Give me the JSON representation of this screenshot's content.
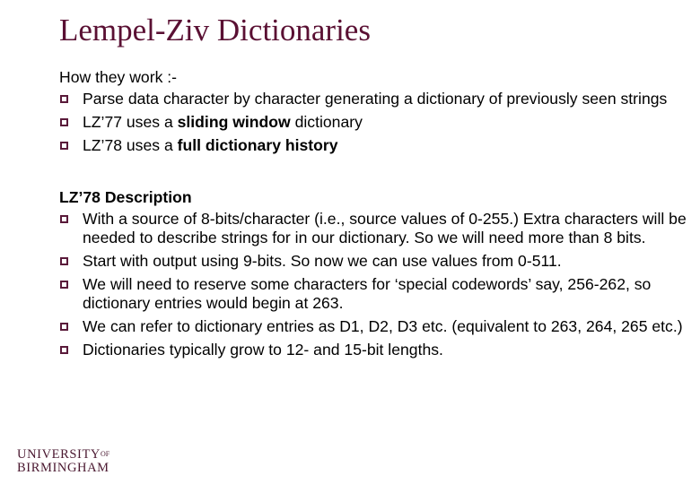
{
  "title": "Lempel-Ziv Dictionaries",
  "section1": {
    "heading": "How they work :-",
    "items": [
      {
        "parts": [
          {
            "text": "Parse data character by character generating a dictionary of previously seen strings",
            "bold": false
          }
        ]
      },
      {
        "parts": [
          {
            "text": "LZ’77 uses a ",
            "bold": false
          },
          {
            "text": "sliding window",
            "bold": true
          },
          {
            "text": " dictionary",
            "bold": false
          }
        ]
      },
      {
        "parts": [
          {
            "text": "LZ’78 uses a ",
            "bold": false
          },
          {
            "text": "full dictionary history",
            "bold": true
          }
        ]
      }
    ]
  },
  "section2": {
    "heading": "LZ’78 Description",
    "items": [
      {
        "parts": [
          {
            "text": "With a source of 8-bits/character (i.e., source values of 0-255.)  Extra characters will be needed to describe strings for in our dictionary. So we will need more than 8 bits.",
            "bold": false
          }
        ]
      },
      {
        "parts": [
          {
            "text": "Start with output using 9-bits.  So now we can use values from 0-511.",
            "bold": false
          }
        ]
      },
      {
        "parts": [
          {
            "text": "We will need to reserve some characters for ‘special codewords’ say, 256-262, so dictionary entries would begin at 263.",
            "bold": false
          }
        ]
      },
      {
        "parts": [
          {
            "text": "We can refer to dictionary entries as D1, D2, D3 etc. (equivalent to 263, 264, 265 etc.)",
            "bold": false
          }
        ]
      },
      {
        "parts": [
          {
            "text": "Dictionaries typically grow to 12- and 15-bit lengths.",
            "bold": false
          }
        ]
      }
    ]
  },
  "logo": {
    "line1": "UNIVERSITY",
    "of": "OF",
    "line2": "BIRMINGHAM"
  },
  "colors": {
    "title": "#5a1033",
    "bullet": "#5a1a3a",
    "logo": "#4a1830"
  },
  "icons": {
    "bullet": "hollow-square-bullet-icon"
  }
}
